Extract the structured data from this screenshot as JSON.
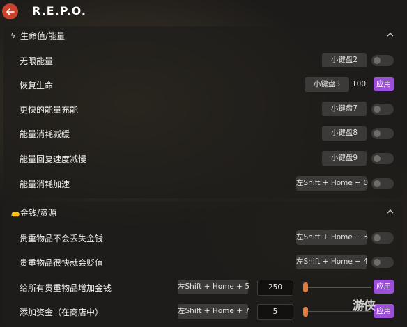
{
  "app": {
    "title": "R.E.P.O."
  },
  "sections": [
    {
      "title": "生命值/能量",
      "icon": "lightning-icon",
      "rows": [
        {
          "label": "无限能量",
          "key": "小键盘2",
          "control": "toggle",
          "on": false
        },
        {
          "label": "恢复生命",
          "key": "小键盘3",
          "control": "apply",
          "value": "100",
          "apply_label": "应用"
        },
        {
          "label": "更快的能量充能",
          "key": "小键盘7",
          "control": "toggle",
          "on": false
        },
        {
          "label": "能量消耗减缓",
          "key": "小键盘8",
          "control": "toggle",
          "on": false
        },
        {
          "label": "能量回复速度减慢",
          "key": "小键盘9",
          "control": "toggle",
          "on": false
        },
        {
          "label": "能量消耗加速",
          "key": "左Shift + Home + 0",
          "control": "toggle",
          "on": false
        }
      ]
    },
    {
      "title": "金钱/资源",
      "icon": "money-bag-icon",
      "rows": [
        {
          "label": "贵重物品不会丢失金钱",
          "key": "左Shift + Home + 3",
          "control": "toggle",
          "on": false
        },
        {
          "label": "贵重物品很快就会贬值",
          "key": "左Shift + Home + 4",
          "control": "toggle",
          "on": false
        },
        {
          "label": "给所有贵重物品增加金钱",
          "key": "左Shift + Home + 5",
          "control": "slider",
          "value": "250",
          "slider_fraction": 0.0,
          "apply_label": "应用"
        },
        {
          "label": "添加资金（在商店中）",
          "key": "左Shift + Home + 7",
          "control": "slider",
          "value": "5",
          "slider_fraction": 0.0,
          "apply_label": "应用"
        }
      ]
    }
  ],
  "watermark": "游侠",
  "colors": {
    "accent_apply": "#9b4fd8",
    "slider_thumb": "#e5783a",
    "back_button": "#c8422e"
  }
}
